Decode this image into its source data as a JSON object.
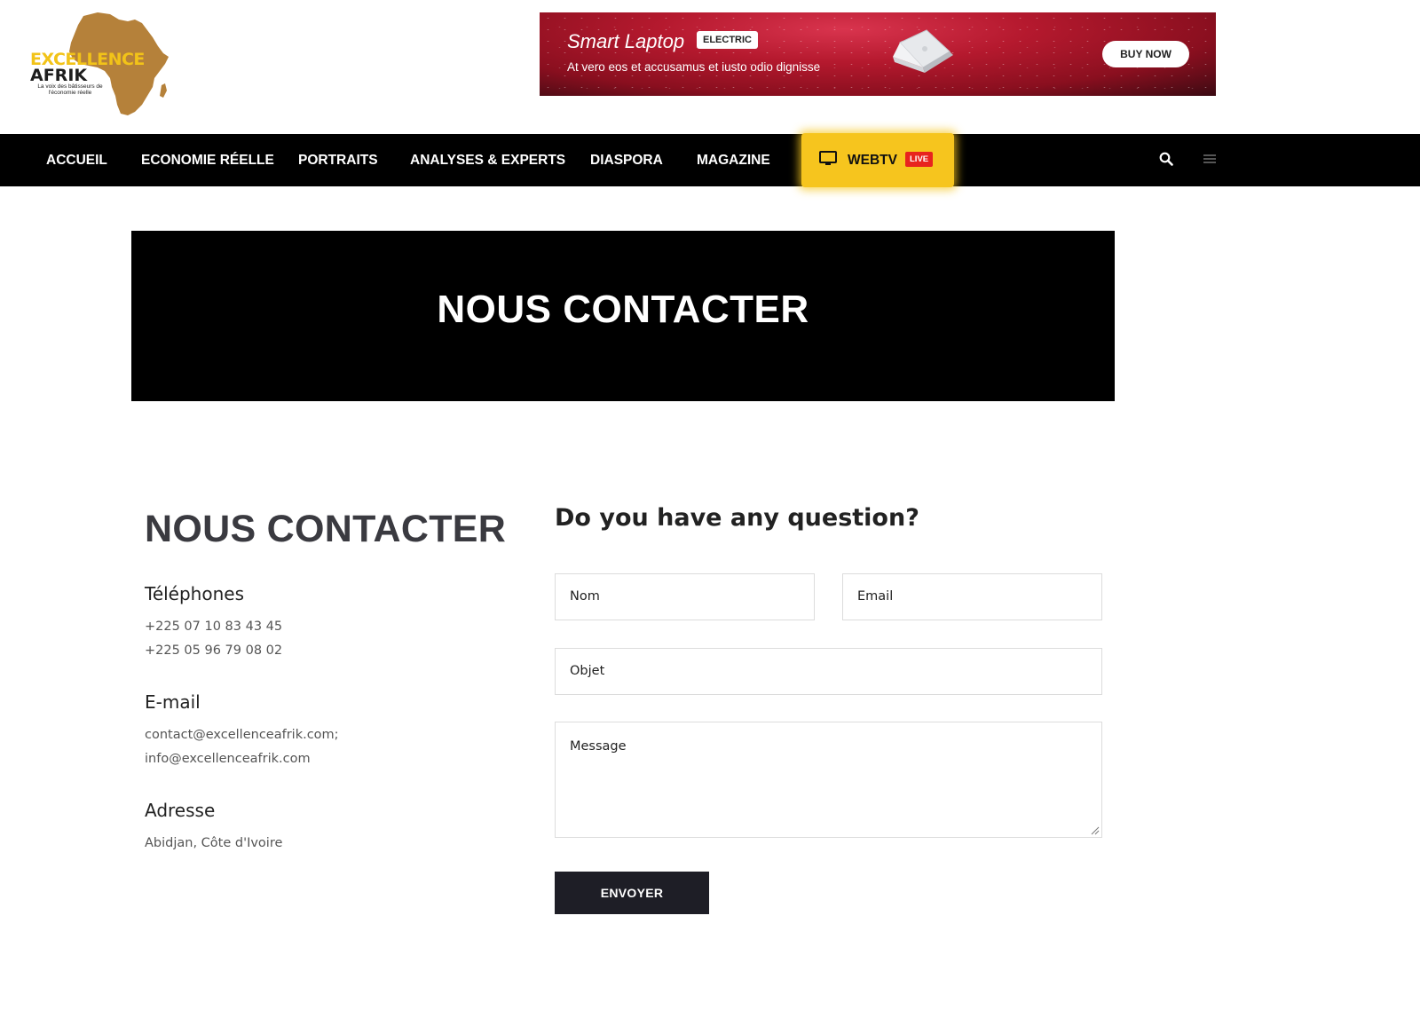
{
  "logo": {
    "word1": "EXCELLENCE",
    "word2": "AFRIK",
    "tagline": "La voix des bâtisseurs de l'économie réelle",
    "colors": {
      "africa": "#b5813a",
      "yellow": "#f2c318"
    }
  },
  "ad": {
    "title": "Smart Laptop",
    "badge": "ELECTRIC",
    "subtitle": "At vero eos et accusamus et iusto odio dignisse",
    "button": "BUY NOW"
  },
  "nav": {
    "items": [
      "ACCUEIL",
      "ECONOMIE RÉELLE",
      "PORTRAITS",
      "ANALYSES & EXPERTS",
      "DIASPORA",
      "MAGAZINE"
    ],
    "webtv": {
      "label": "WEBTV",
      "badge": "LIVE",
      "icon": "tv-icon"
    },
    "icons": [
      "search-icon",
      "menu-icon"
    ],
    "colors": {
      "bar": "#000000",
      "webtv_bg": "#f6c51e",
      "live_bg": "#e8231e"
    }
  },
  "hero": {
    "title": "NOUS CONTACTER"
  },
  "contact": {
    "heading": "NOUS CONTACTER",
    "phones_title": "Téléphones",
    "phones": [
      "+225 07 10 83 43 45",
      "+225 05 96 79 08 02"
    ],
    "email_title": "E-mail",
    "emails": [
      "contact@excellenceafrik.com;",
      "info@excellenceafrik.com"
    ],
    "address_title": "Adresse",
    "address": "Abidjan, Côte d'Ivoire"
  },
  "form": {
    "title": "Do you have any question?",
    "name_placeholder": "Nom",
    "email_placeholder": "Email",
    "subject_placeholder": "Objet",
    "message_placeholder": "Message",
    "submit": "ENVOYER",
    "button_color": "#1e1e26"
  }
}
